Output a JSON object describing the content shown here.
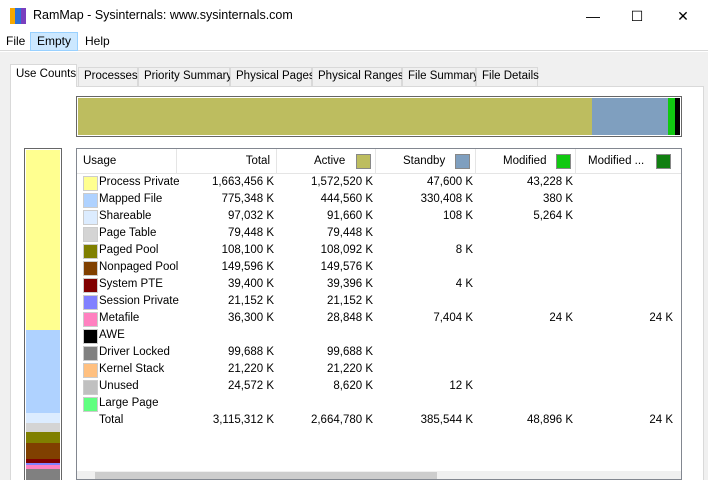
{
  "window": {
    "title": "RamMap - Sysinternals: www.sysinternals.com",
    "minimize": "—",
    "maximize": "☐",
    "close": "✕"
  },
  "menu": [
    "File",
    "Empty",
    "Help"
  ],
  "tabs": [
    "Use Counts",
    "Processes",
    "Priority Summary",
    "Physical Pages",
    "Physical Ranges",
    "File Summary",
    "File Details"
  ],
  "columns": {
    "usage": "Usage",
    "total": "Total",
    "active": "Active",
    "standby": "Standby",
    "modified": "Modified",
    "modified_nw": "Modified ..."
  },
  "column_colors": {
    "active": "#bdbd5f",
    "standby": "#7f9fbf",
    "modified": "#11c911",
    "modified_nw": "#117f11"
  },
  "rows": [
    {
      "name": "Process Private",
      "color": "#ffff90",
      "total": "1,663,456 K",
      "active": "1,572,520 K",
      "standby": "47,600 K",
      "modified": "43,228 K",
      "modified_nw": ""
    },
    {
      "name": "Mapped File",
      "color": "#afd2ff",
      "total": "775,348 K",
      "active": "444,560 K",
      "standby": "330,408 K",
      "modified": "380 K",
      "modified_nw": ""
    },
    {
      "name": "Shareable",
      "color": "#dcecff",
      "total": "97,032 K",
      "active": "91,660 K",
      "standby": "108 K",
      "modified": "5,264 K",
      "modified_nw": ""
    },
    {
      "name": "Page Table",
      "color": "#d4d4d4",
      "total": "79,448 K",
      "active": "79,448 K",
      "standby": "",
      "modified": "",
      "modified_nw": ""
    },
    {
      "name": "Paged Pool",
      "color": "#808000",
      "total": "108,100 K",
      "active": "108,092 K",
      "standby": "8 K",
      "modified": "",
      "modified_nw": ""
    },
    {
      "name": "Nonpaged Pool",
      "color": "#804000",
      "total": "149,596 K",
      "active": "149,576 K",
      "standby": "",
      "modified": "",
      "modified_nw": ""
    },
    {
      "name": "System PTE",
      "color": "#800000",
      "total": "39,400 K",
      "active": "39,396 K",
      "standby": "4 K",
      "modified": "",
      "modified_nw": ""
    },
    {
      "name": "Session Private",
      "color": "#8080ff",
      "total": "21,152 K",
      "active": "21,152 K",
      "standby": "",
      "modified": "",
      "modified_nw": ""
    },
    {
      "name": "Metafile",
      "color": "#ff80c0",
      "total": "36,300 K",
      "active": "28,848 K",
      "standby": "7,404 K",
      "modified": "24 K",
      "modified_nw": "24 K"
    },
    {
      "name": "AWE",
      "color": "#000000",
      "total": "",
      "active": "",
      "standby": "",
      "modified": "",
      "modified_nw": ""
    },
    {
      "name": "Driver Locked",
      "color": "#808080",
      "total": "99,688 K",
      "active": "99,688 K",
      "standby": "",
      "modified": "",
      "modified_nw": ""
    },
    {
      "name": "Kernel Stack",
      "color": "#ffc080",
      "total": "21,220 K",
      "active": "21,220 K",
      "standby": "",
      "modified": "",
      "modified_nw": ""
    },
    {
      "name": "Unused",
      "color": "#c0c0c0",
      "total": "24,572 K",
      "active": "8,620 K",
      "standby": "12 K",
      "modified": "",
      "modified_nw": ""
    },
    {
      "name": "Large Page",
      "color": "#60ff80",
      "total": "",
      "active": "",
      "standby": "",
      "modified": "",
      "modified_nw": ""
    },
    {
      "name": "Total",
      "color": "",
      "total": "3,115,312 K",
      "active": "2,664,780 K",
      "standby": "385,544 K",
      "modified": "48,896 K",
      "modified_nw": "24 K"
    }
  ]
}
